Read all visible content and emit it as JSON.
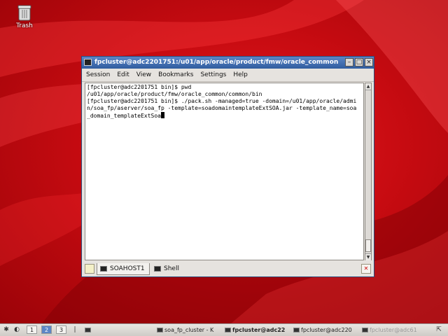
{
  "desktop": {
    "icons": [
      {
        "label": "Trash",
        "icon": "trash-icon"
      }
    ]
  },
  "window": {
    "title": "fpcluster@adc2201751:/u01/app/oracle/product/fmw/oracle_common",
    "controls": {
      "minimize": "–",
      "maximize": "□",
      "close": "×"
    },
    "menu": [
      "Session",
      "Edit",
      "View",
      "Bookmarks",
      "Settings",
      "Help"
    ],
    "terminal": {
      "lines": [
        "[fpcluster@adc2201751 bin]$ pwd",
        "/u01/app/oracle/product/fmw/oracle_common/common/bin",
        "[fpcluster@adc2201751 bin]$ ./pack.sh -managed=true -domain=/u01/app/oracle/admi",
        "n/soa_fp/aserver/soa_fp -template=soadomaintemplateExtSOA.jar -template_name=soa",
        "_domain_templateExtSoa"
      ]
    },
    "tabs": [
      {
        "label": "SOAHOST1",
        "active": true,
        "icon": "terminal-icon"
      },
      {
        "label": "Shell",
        "active": false,
        "icon": "terminal-icon"
      }
    ]
  },
  "taskbar": {
    "workspaces": [
      "1",
      "2",
      "3"
    ],
    "active_workspace": "2",
    "tasks": [
      {
        "label": "soa_fp_cluster - K",
        "style": "normal"
      },
      {
        "label": "fpcluster@adc22",
        "style": "bold"
      },
      {
        "label": "fpcluster@adc220",
        "style": "normal"
      },
      {
        "label": "fpcluster@adc61",
        "style": "dim"
      }
    ]
  },
  "colors": {
    "wallpaper": "#c8090f",
    "titlebar": "#2f5c9f",
    "active_workspace": "#5b86c6"
  }
}
